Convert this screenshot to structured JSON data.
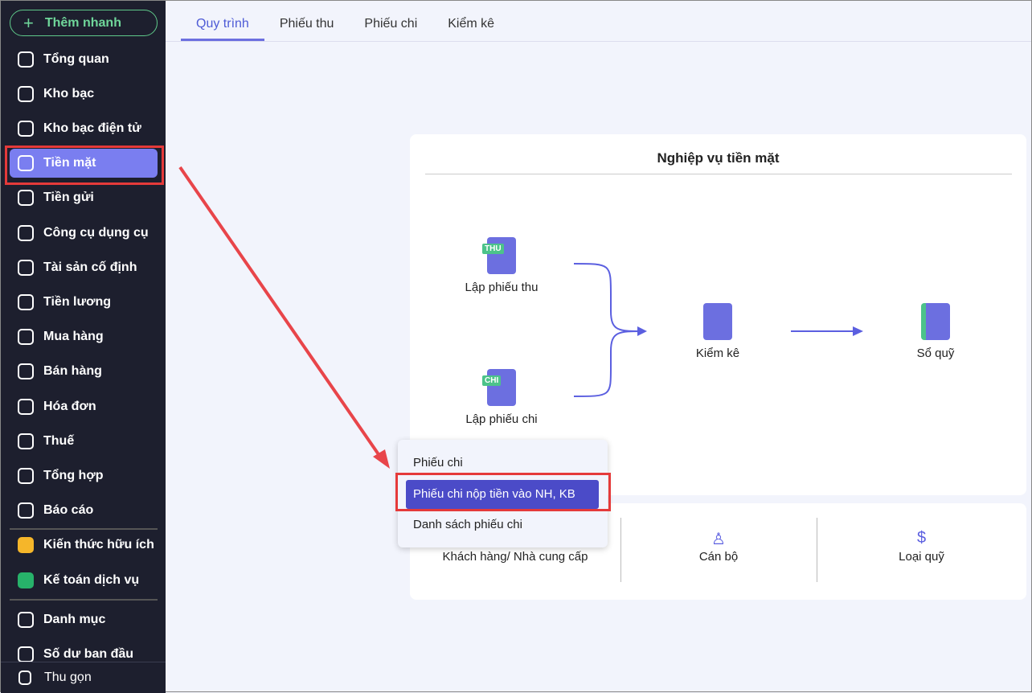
{
  "sidebar": {
    "add_label": "Thêm nhanh",
    "items": [
      {
        "label": "Tổng quan",
        "icon": "pie-chart-icon"
      },
      {
        "label": "Kho bạc",
        "icon": "treasury-icon"
      },
      {
        "label": "Kho bạc điện tử",
        "icon": "e-treasury-icon"
      },
      {
        "label": "Tiền mặt",
        "icon": "cash-icon"
      },
      {
        "label": "Tiền gửi",
        "icon": "deposit-icon"
      },
      {
        "label": "Công cụ dụng cụ",
        "icon": "tools-icon"
      },
      {
        "label": "Tài sản cố định",
        "icon": "truck-icon"
      },
      {
        "label": "Tiền lương",
        "icon": "salary-icon"
      },
      {
        "label": "Mua hàng",
        "icon": "cart-icon"
      },
      {
        "label": "Bán hàng",
        "icon": "store-icon"
      },
      {
        "label": "Hóa đơn",
        "icon": "invoice-icon"
      },
      {
        "label": "Thuế",
        "icon": "bank-icon"
      },
      {
        "label": "Tổng hợp",
        "icon": "summary-icon"
      },
      {
        "label": "Báo cáo",
        "icon": "report-icon"
      },
      {
        "label": "Kiến thức hữu ích",
        "icon": "knowledge-icon"
      },
      {
        "label": "Kế toán dịch vụ",
        "icon": "service-icon"
      },
      {
        "label": "Danh mục",
        "icon": "list-icon"
      },
      {
        "label": "Số dư ban đầu",
        "icon": "balance-icon"
      }
    ],
    "collapse_label": "Thu gọn",
    "active": "Tiền mặt"
  },
  "tabs": [
    "Quy trình",
    "Phiếu thu",
    "Phiếu chi",
    "Kiểm kê"
  ],
  "process": {
    "title": "Nghiệp vụ tiền mặt",
    "receipt": "Lập phiếu thu",
    "receipt_tag": "THU",
    "payment": "Lập phiếu chi",
    "payment_tag": "CHI",
    "inventory": "Kiểm kê",
    "ledger": "Sổ quỹ"
  },
  "bottom": [
    "Khách hàng/ Nhà cung cấp",
    "Cán bộ",
    "Loại quỹ"
  ],
  "dropdown": [
    "Phiếu chi",
    "Phiếu chi nộp tiền vào NH, KB",
    "Danh sách phiếu chi"
  ],
  "colors": {
    "accent": "#6c6fe0",
    "highlight": "#e53a3a",
    "sidebar": "#1d1f2e"
  }
}
